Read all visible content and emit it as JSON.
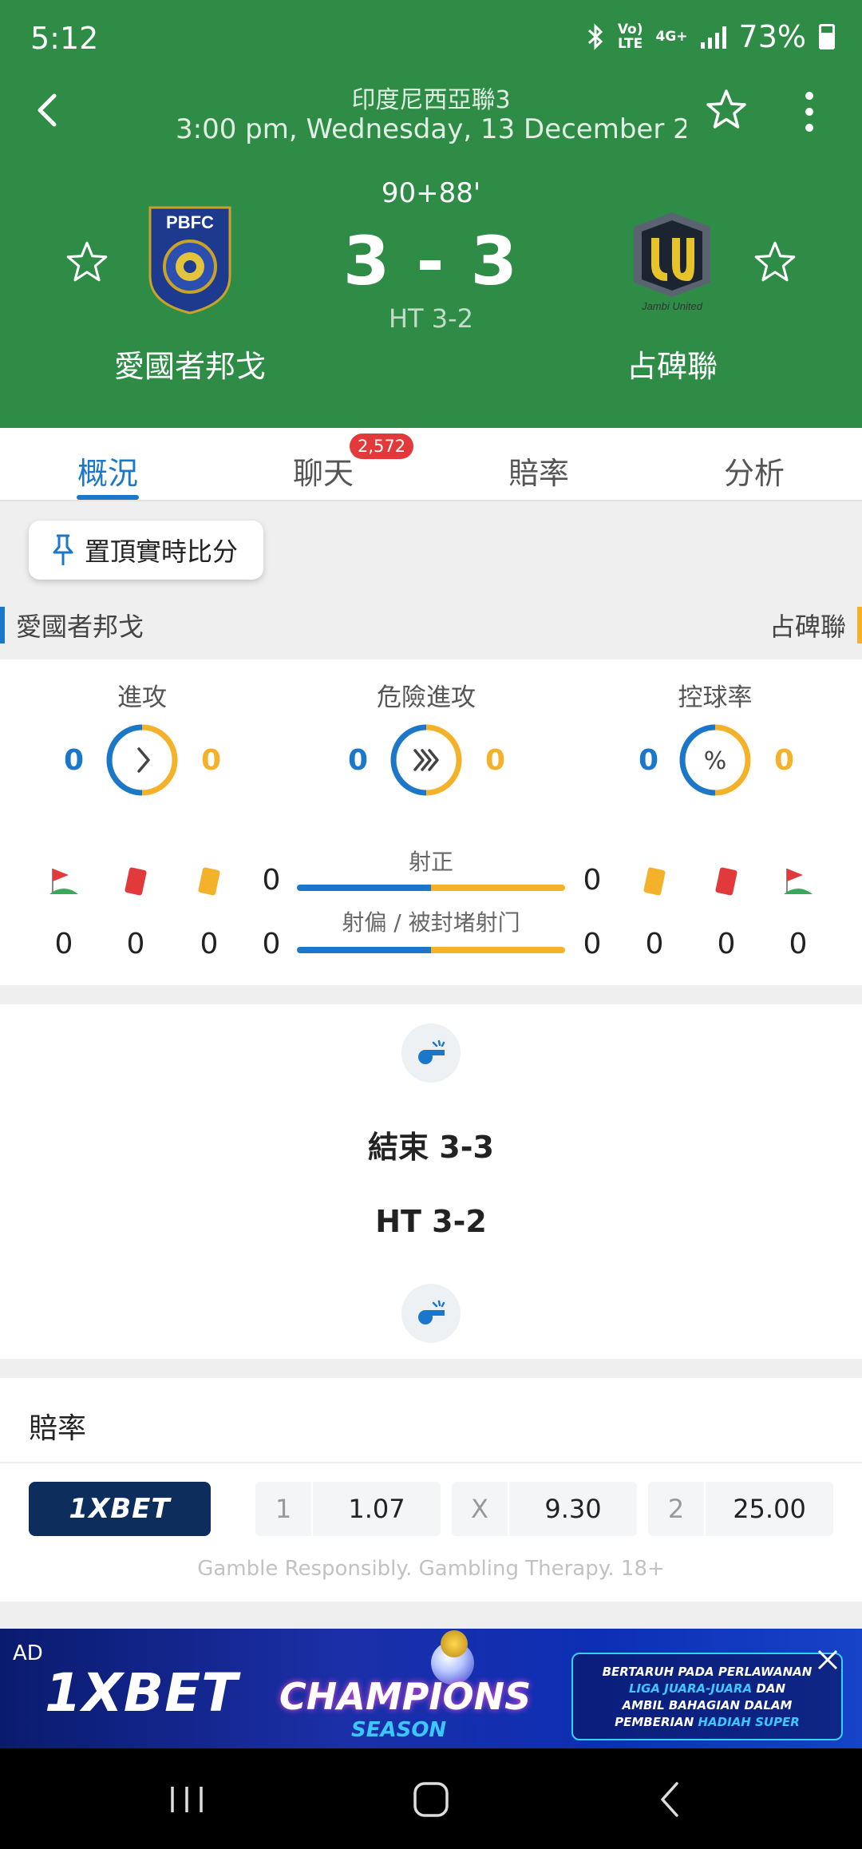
{
  "status": {
    "time": "5:12",
    "net1": "Vo)",
    "net1b": "LTE",
    "net2": "4G+",
    "battery": "73%"
  },
  "match": {
    "league": "印度尼西亞聯3",
    "datetime": "3:00 pm, Wednesday, 13 December 2...",
    "minute": "90+88'",
    "score": "3 - 3",
    "ht": "HT 3-2",
    "home_name": "愛國者邦戈",
    "away_name": "占碑聯",
    "home_logo_text": "PBFC",
    "away_logo_text": "Jambi United"
  },
  "tabs": [
    {
      "label": "概況",
      "active": true
    },
    {
      "label": "聊天",
      "badge": "2,572"
    },
    {
      "label": "賠率"
    },
    {
      "label": "分析"
    }
  ],
  "pin_label": "置頂實時比分",
  "team_row": {
    "home": "愛國者邦戈",
    "away": "占碑聯"
  },
  "stats": {
    "attacks": {
      "label": "進攻",
      "home": "0",
      "away": "0",
      "home_share": 0.5
    },
    "dangerous": {
      "label": "危險進攻",
      "home": "0",
      "away": "0",
      "home_share": 0.5
    },
    "possession": {
      "label": "控球率",
      "home": "0",
      "away": "0",
      "home_share": 0.5
    },
    "shots_on": {
      "label": "射正",
      "home": "0",
      "away": "0",
      "home_share": 0.5
    },
    "shots_off": {
      "label": "射偏 / 被封堵射门",
      "home": "0",
      "away": "0",
      "home_share": 0.5
    },
    "home_corners": "0",
    "home_reds": "0",
    "home_yellows": "0",
    "away_yellows": "0",
    "away_reds": "0",
    "away_corners": "0"
  },
  "events": {
    "end": "結束 3-3",
    "ht": "HT 3-2"
  },
  "odds": {
    "title": "賠率",
    "bookmaker": "1XBET",
    "home_key": "1",
    "home_val": "1.07",
    "draw_key": "X",
    "draw_val": "9.30",
    "away_key": "2",
    "away_val": "25.00",
    "disclaimer": "Gamble Responsibly. Gambling Therapy. 18+"
  },
  "ad": {
    "tag": "AD",
    "logo": "1XBET",
    "champ": "CHAMPIONS",
    "season": "SEASON",
    "line1": "BERTARUH PADA PERLAWANAN",
    "line2": "LIGA JUARA-JUARA",
    "line2b": " DAN",
    "line3": "AMBIL BAHAGIAN DALAM",
    "line4": "PEMBERIAN ",
    "line4b": "HADIAH SUPER"
  },
  "colors": {
    "header": "#2f8c46",
    "home": "#1a77c9",
    "away": "#f3b22a",
    "accent": "#1a77c9"
  }
}
